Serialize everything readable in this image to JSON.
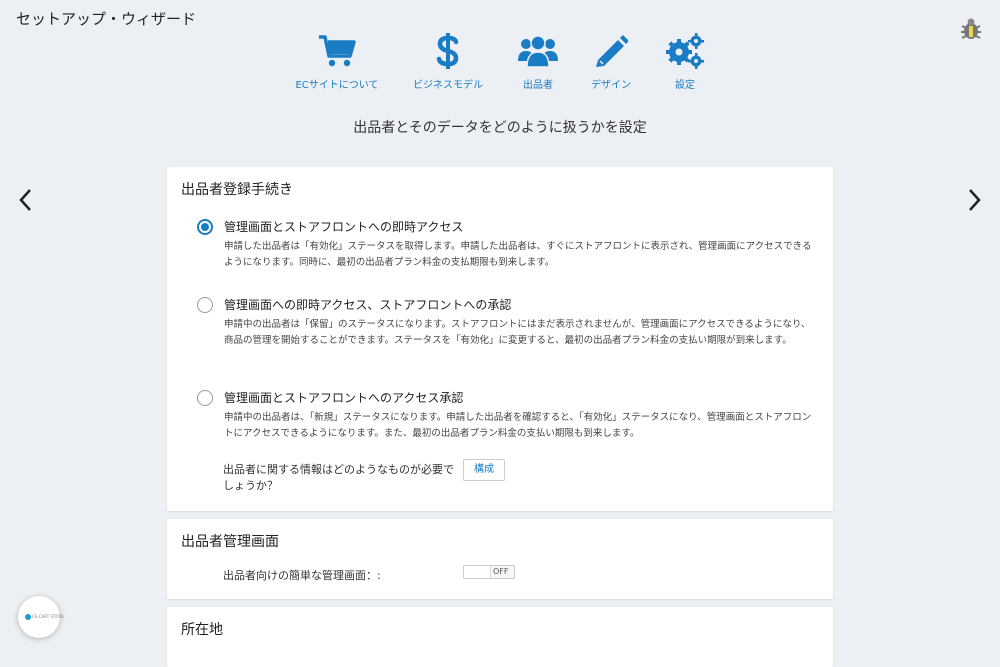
{
  "header": {
    "title": "セットアップ・ウィザード"
  },
  "steps": [
    {
      "label": "ECサイトについて",
      "icon": "shopping-cart-icon"
    },
    {
      "label": "ビジネスモデル",
      "icon": "dollar-icon"
    },
    {
      "label": "出品者",
      "icon": "users-icon"
    },
    {
      "label": "デザイン",
      "icon": "pencil-icon"
    },
    {
      "label": "設定",
      "icon": "gears-icon"
    }
  ],
  "subtitle": "出品者とそのデータをどのように扱うかを設定",
  "registration": {
    "title": "出品者登録手続き",
    "selected": 0,
    "options": [
      {
        "title": "管理画面とストアフロントへの即時アクセス",
        "description": "申請した出品者は「有効化」ステータスを取得します。申請した出品者は、すぐにストアフロントに表示され、管理画面にアクセスできるようになります。同時に、最初の出品者プラン料金の支払期限も到来します。"
      },
      {
        "title": "管理画面への即時アクセス、ストアフロントへの承認",
        "description": "申請中の出品者は「保留」のステータスになります。ストアフロントにはまだ表示されませんが、管理画面にアクセスできるようになり、商品の管理を開始することができます。ステータスを「有効化」に変更すると、最初の出品者プラン料金の支払い期限が到来します。"
      },
      {
        "title": "管理画面とストアフロントへのアクセス承認",
        "description": "申請中の出品者は、「新規」ステータスになります。申請した出品者を確認すると、「有効化」ステータスになり、管理画面とストアフロントにアクセスできるようになります。また、最初の出品者プラン料金の支払い期限も到来します。"
      }
    ],
    "question": "出品者に関する情報はどのようなものが必要でしょうか？",
    "configure_label": "構成"
  },
  "admin_panel": {
    "title": "出品者管理画面",
    "simple_label": "出品者向けの簡単な管理画面：:",
    "toggle_state": "OFF"
  },
  "location": {
    "title": "所在地"
  },
  "widget": {
    "label": "CS-CART STORE"
  },
  "colors": {
    "accent": "#1a7cc4",
    "background": "#eceff3"
  }
}
